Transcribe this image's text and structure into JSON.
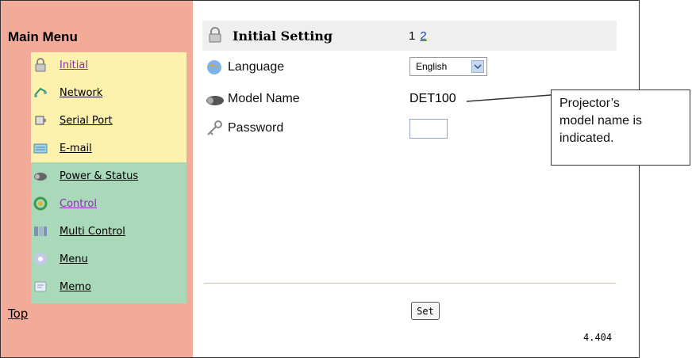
{
  "sidebar": {
    "title": "Main Menu",
    "items": [
      {
        "label": "Initial",
        "icon": "lock-icon",
        "visited": true
      },
      {
        "label": "Network",
        "icon": "network-icon",
        "visited": false
      },
      {
        "label": "Serial Port",
        "icon": "serial-port-icon",
        "visited": false
      },
      {
        "label": "E-mail",
        "icon": "email-icon",
        "visited": false
      },
      {
        "label": "Power & Status",
        "icon": "projector-icon",
        "visited": false
      },
      {
        "label": "Control",
        "icon": "control-icon",
        "visited": true
      },
      {
        "label": "Multi Control",
        "icon": "multi-control-icon",
        "visited": false
      },
      {
        "label": "Menu",
        "icon": "menu-icon",
        "visited": false
      },
      {
        "label": "Memo",
        "icon": "memo-icon",
        "visited": false
      }
    ],
    "top_link": "Top"
  },
  "main": {
    "header": {
      "title": "Initial Setting",
      "page_current": "1",
      "page_link": "2"
    },
    "language": {
      "label": "Language",
      "value": "English"
    },
    "model": {
      "label": "Model Name",
      "value": "DET100"
    },
    "password": {
      "label": "Password",
      "value": ""
    },
    "set_button": "Set",
    "version": "4.404"
  },
  "callout": {
    "line1": "Projector’s",
    "line2": "model name is",
    "line3": "indicated."
  },
  "colors": {
    "sidebar": "#f3ab99",
    "group_yellow": "#fdf1ae",
    "group_green": "#a9d9b8",
    "header_bar": "#efefef"
  }
}
